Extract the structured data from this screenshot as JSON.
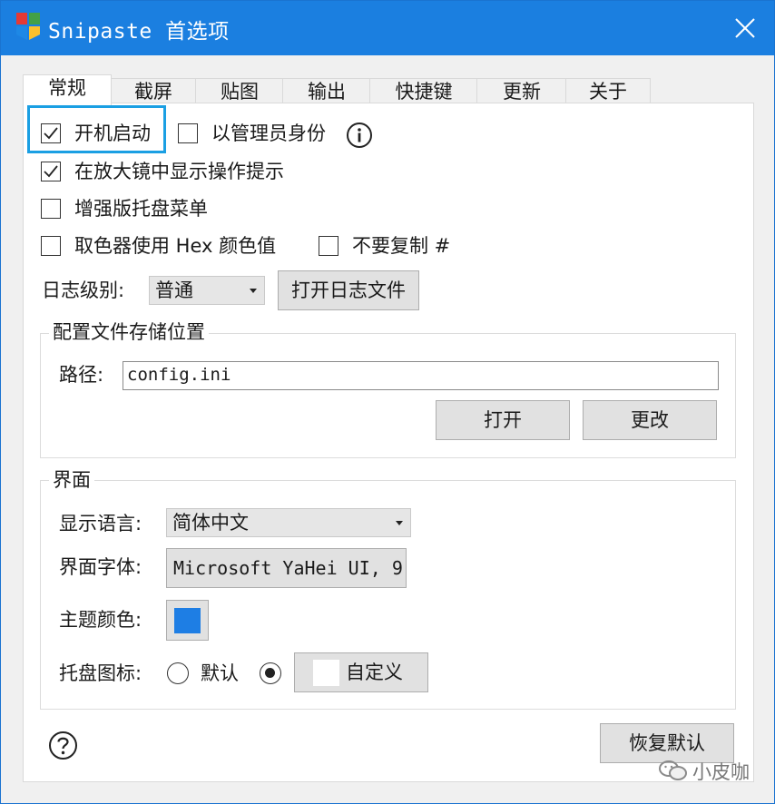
{
  "window": {
    "title": "Snipaste 首选项",
    "accent": "#1b7fe0"
  },
  "tabs": [
    {
      "label": "常规",
      "active": true
    },
    {
      "label": "截屏"
    },
    {
      "label": "贴图"
    },
    {
      "label": "输出"
    },
    {
      "label": "快捷键"
    },
    {
      "label": "更新"
    },
    {
      "label": "关于"
    }
  ],
  "general": {
    "autostart": {
      "label": "开机启动",
      "checked": true
    },
    "as_admin": {
      "label": "以管理员身份",
      "checked": false
    },
    "magnifier_hints": {
      "label": "在放大镜中显示操作提示",
      "checked": true
    },
    "enhanced_tray_menu": {
      "label": "增强版托盘菜单",
      "checked": false
    },
    "hex_color": {
      "label": "取色器使用 Hex 颜色值",
      "checked": false
    },
    "no_hash": {
      "label": "不要复制 #",
      "checked": false
    },
    "log_level": {
      "label": "日志级别:",
      "value": "普通"
    },
    "open_log_button": "打开日志文件"
  },
  "config_group": {
    "title": "配置文件存储位置",
    "path_label": "路径:",
    "path_value": "config.ini",
    "open_button": "打开",
    "change_button": "更改"
  },
  "ui_group": {
    "title": "界面",
    "language_label": "显示语言:",
    "language_value": "简体中文",
    "font_label": "界面字体:",
    "font_value": "Microsoft YaHei UI, 9",
    "theme_label": "主题颜色:",
    "theme_color": "#1e7ee4",
    "tray_label": "托盘图标:",
    "tray_default": "默认",
    "tray_custom": "自定义",
    "tray_selected": "custom"
  },
  "footer": {
    "restore_button": "恢复默认",
    "watermark": "小皮咖"
  }
}
